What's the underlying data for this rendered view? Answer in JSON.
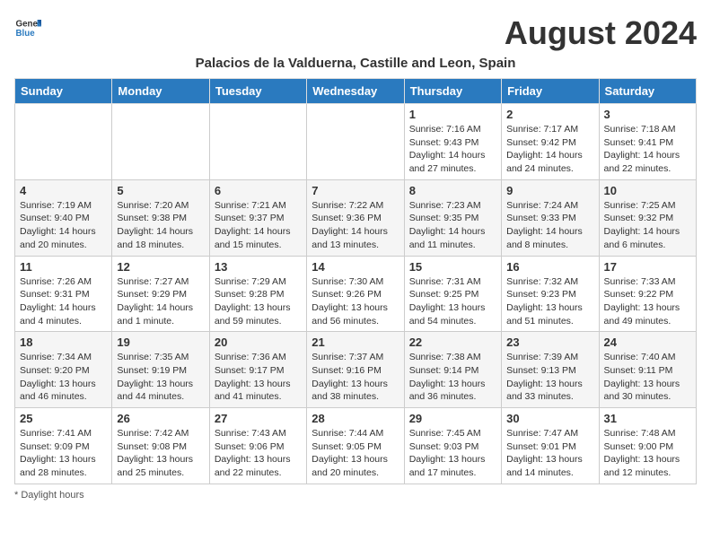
{
  "logo": {
    "text_general": "General",
    "text_blue": "Blue"
  },
  "calendar": {
    "title": "August 2024",
    "subtitle": "Palacios de la Valduerna, Castille and Leon, Spain",
    "days_of_week": [
      "Sunday",
      "Monday",
      "Tuesday",
      "Wednesday",
      "Thursday",
      "Friday",
      "Saturday"
    ],
    "weeks": [
      [
        {
          "day": "",
          "info": ""
        },
        {
          "day": "",
          "info": ""
        },
        {
          "day": "",
          "info": ""
        },
        {
          "day": "",
          "info": ""
        },
        {
          "day": "1",
          "info": "Sunrise: 7:16 AM\nSunset: 9:43 PM\nDaylight: 14 hours and 27 minutes."
        },
        {
          "day": "2",
          "info": "Sunrise: 7:17 AM\nSunset: 9:42 PM\nDaylight: 14 hours and 24 minutes."
        },
        {
          "day": "3",
          "info": "Sunrise: 7:18 AM\nSunset: 9:41 PM\nDaylight: 14 hours and 22 minutes."
        }
      ],
      [
        {
          "day": "4",
          "info": "Sunrise: 7:19 AM\nSunset: 9:40 PM\nDaylight: 14 hours and 20 minutes."
        },
        {
          "day": "5",
          "info": "Sunrise: 7:20 AM\nSunset: 9:38 PM\nDaylight: 14 hours and 18 minutes."
        },
        {
          "day": "6",
          "info": "Sunrise: 7:21 AM\nSunset: 9:37 PM\nDaylight: 14 hours and 15 minutes."
        },
        {
          "day": "7",
          "info": "Sunrise: 7:22 AM\nSunset: 9:36 PM\nDaylight: 14 hours and 13 minutes."
        },
        {
          "day": "8",
          "info": "Sunrise: 7:23 AM\nSunset: 9:35 PM\nDaylight: 14 hours and 11 minutes."
        },
        {
          "day": "9",
          "info": "Sunrise: 7:24 AM\nSunset: 9:33 PM\nDaylight: 14 hours and 8 minutes."
        },
        {
          "day": "10",
          "info": "Sunrise: 7:25 AM\nSunset: 9:32 PM\nDaylight: 14 hours and 6 minutes."
        }
      ],
      [
        {
          "day": "11",
          "info": "Sunrise: 7:26 AM\nSunset: 9:31 PM\nDaylight: 14 hours and 4 minutes."
        },
        {
          "day": "12",
          "info": "Sunrise: 7:27 AM\nSunset: 9:29 PM\nDaylight: 14 hours and 1 minute."
        },
        {
          "day": "13",
          "info": "Sunrise: 7:29 AM\nSunset: 9:28 PM\nDaylight: 13 hours and 59 minutes."
        },
        {
          "day": "14",
          "info": "Sunrise: 7:30 AM\nSunset: 9:26 PM\nDaylight: 13 hours and 56 minutes."
        },
        {
          "day": "15",
          "info": "Sunrise: 7:31 AM\nSunset: 9:25 PM\nDaylight: 13 hours and 54 minutes."
        },
        {
          "day": "16",
          "info": "Sunrise: 7:32 AM\nSunset: 9:23 PM\nDaylight: 13 hours and 51 minutes."
        },
        {
          "day": "17",
          "info": "Sunrise: 7:33 AM\nSunset: 9:22 PM\nDaylight: 13 hours and 49 minutes."
        }
      ],
      [
        {
          "day": "18",
          "info": "Sunrise: 7:34 AM\nSunset: 9:20 PM\nDaylight: 13 hours and 46 minutes."
        },
        {
          "day": "19",
          "info": "Sunrise: 7:35 AM\nSunset: 9:19 PM\nDaylight: 13 hours and 44 minutes."
        },
        {
          "day": "20",
          "info": "Sunrise: 7:36 AM\nSunset: 9:17 PM\nDaylight: 13 hours and 41 minutes."
        },
        {
          "day": "21",
          "info": "Sunrise: 7:37 AM\nSunset: 9:16 PM\nDaylight: 13 hours and 38 minutes."
        },
        {
          "day": "22",
          "info": "Sunrise: 7:38 AM\nSunset: 9:14 PM\nDaylight: 13 hours and 36 minutes."
        },
        {
          "day": "23",
          "info": "Sunrise: 7:39 AM\nSunset: 9:13 PM\nDaylight: 13 hours and 33 minutes."
        },
        {
          "day": "24",
          "info": "Sunrise: 7:40 AM\nSunset: 9:11 PM\nDaylight: 13 hours and 30 minutes."
        }
      ],
      [
        {
          "day": "25",
          "info": "Sunrise: 7:41 AM\nSunset: 9:09 PM\nDaylight: 13 hours and 28 minutes."
        },
        {
          "day": "26",
          "info": "Sunrise: 7:42 AM\nSunset: 9:08 PM\nDaylight: 13 hours and 25 minutes."
        },
        {
          "day": "27",
          "info": "Sunrise: 7:43 AM\nSunset: 9:06 PM\nDaylight: 13 hours and 22 minutes."
        },
        {
          "day": "28",
          "info": "Sunrise: 7:44 AM\nSunset: 9:05 PM\nDaylight: 13 hours and 20 minutes."
        },
        {
          "day": "29",
          "info": "Sunrise: 7:45 AM\nSunset: 9:03 PM\nDaylight: 13 hours and 17 minutes."
        },
        {
          "day": "30",
          "info": "Sunrise: 7:47 AM\nSunset: 9:01 PM\nDaylight: 13 hours and 14 minutes."
        },
        {
          "day": "31",
          "info": "Sunrise: 7:48 AM\nSunset: 9:00 PM\nDaylight: 13 hours and 12 minutes."
        }
      ]
    ],
    "footer": "Daylight hours"
  }
}
